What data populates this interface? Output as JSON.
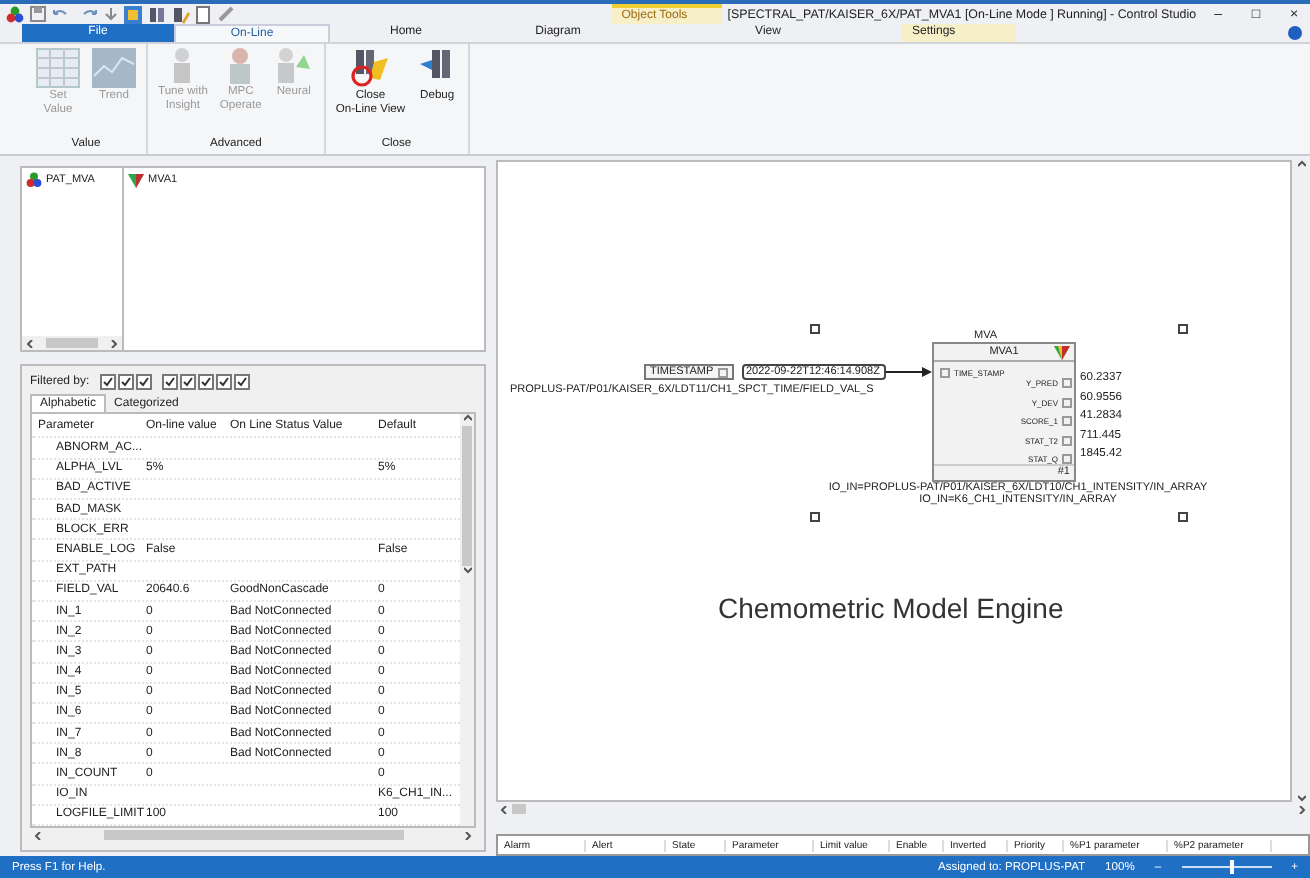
{
  "window": {
    "object_tools": "Object Tools",
    "title": "[SPECTRAL_PAT/KAISER_6X/PAT_MVA1 [On-Line Mode ] Running] - Control Studio",
    "minimize": "–",
    "maximize": "□",
    "close": "×"
  },
  "tabs": [
    {
      "label": "File",
      "kind": "file",
      "selected": false
    },
    {
      "label": "On-Line",
      "kind": "tab",
      "selected": true
    },
    {
      "label": "Home",
      "kind": "tab",
      "selected": false
    },
    {
      "label": "Diagram",
      "kind": "tab",
      "selected": false
    },
    {
      "label": "View",
      "kind": "tab",
      "selected": false
    },
    {
      "label": "Settings",
      "kind": "context",
      "selected": false
    }
  ],
  "ribbon": [
    {
      "label": "Value",
      "buttons": [
        {
          "label": "Set\nValue",
          "kind": "grid",
          "disabled": true
        },
        {
          "label": "Trend",
          "kind": "trend",
          "disabled": true
        }
      ]
    },
    {
      "label": "Advanced",
      "buttons": [
        {
          "label": "Tune with\nInsight",
          "kind": "tune",
          "disabled": true
        },
        {
          "label": "MPC\nOperate",
          "kind": "mpc",
          "disabled": true
        },
        {
          "label": "Neural",
          "kind": "neural",
          "disabled": true
        }
      ]
    },
    {
      "label": "Close",
      "buttons": [
        {
          "label": "Close\nOn-Line View",
          "kind": "close",
          "disabled": false
        },
        {
          "label": "Debug",
          "kind": "debug",
          "disabled": false
        }
      ]
    }
  ],
  "tree": {
    "root": "PAT_MVA",
    "items": [
      "MVA1"
    ]
  },
  "filter": {
    "label": "Filtered by:",
    "groups": [
      [
        true,
        true,
        true
      ],
      [
        true,
        true,
        true,
        true,
        true
      ]
    ]
  },
  "property_tabs": [
    {
      "label": "Alphabetic",
      "selected": true
    },
    {
      "label": "Categorized",
      "selected": false
    }
  ],
  "properties": {
    "columns": [
      "Parameter",
      "On-line value",
      "On Line Status Value",
      "Default"
    ],
    "rows": [
      [
        "ABNORM_AC...",
        "",
        "",
        ""
      ],
      [
        "ALPHA_LVL",
        "5%",
        "",
        "5%"
      ],
      [
        "BAD_ACTIVE",
        "",
        "",
        ""
      ],
      [
        "BAD_MASK",
        "",
        "",
        ""
      ],
      [
        "BLOCK_ERR",
        "",
        "",
        ""
      ],
      [
        "ENABLE_LOG",
        "False",
        "",
        "False"
      ],
      [
        "EXT_PATH",
        "",
        "",
        ""
      ],
      [
        "FIELD_VAL",
        "20640.6",
        "GoodNonCascade",
        "0"
      ],
      [
        "IN_1",
        "0",
        "Bad NotConnected",
        "0"
      ],
      [
        "IN_2",
        "0",
        "Bad NotConnected",
        "0"
      ],
      [
        "IN_3",
        "0",
        "Bad NotConnected",
        "0"
      ],
      [
        "IN_4",
        "0",
        "Bad NotConnected",
        "0"
      ],
      [
        "IN_5",
        "0",
        "Bad NotConnected",
        "0"
      ],
      [
        "IN_6",
        "0",
        "Bad NotConnected",
        "0"
      ],
      [
        "IN_7",
        "0",
        "Bad NotConnected",
        "0"
      ],
      [
        "IN_8",
        "0",
        "Bad NotConnected",
        "0"
      ],
      [
        "IN_COUNT",
        "0",
        "",
        "0"
      ],
      [
        "IO_IN",
        "",
        "",
        "K6_CH1_IN..."
      ],
      [
        "LOGFILE_LIMIT",
        "100",
        "",
        "100"
      ]
    ]
  },
  "diagram": {
    "input_name": "TIMESTAMP",
    "input_value": "2022-09-22T12:46:14.908Z",
    "input_path": "PROPLUS-PAT/P01/KAISER_6X/LDT11/CH1_SPCT_TIME/FIELD_VAL_S",
    "block_type": "MVA",
    "block_name": "MVA1",
    "block_input": "TIME_STAMP",
    "block_number": "#1",
    "outputs": [
      {
        "name": "Y_PRED",
        "value": "60.2337"
      },
      {
        "name": "Y_DEV",
        "value": "60.9556"
      },
      {
        "name": "SCORE_1",
        "value": "41.2834"
      },
      {
        "name": "STAT_T2",
        "value": "711.445"
      },
      {
        "name": "STAT_Q",
        "value": "1845.42"
      }
    ],
    "io_lines": [
      "IO_IN=PROPLUS-PAT/P01/KAISER_6X/LDT10/CH1_INTENSITY/IN_ARRAY",
      "IO_IN=K6_CH1_INTENSITY/IN_ARRAY"
    ],
    "caption": "Chemometric Model Engine"
  },
  "alarms": {
    "columns": [
      "Alarm",
      "Alert",
      "State",
      "Parameter",
      "Limit value",
      "Enable",
      "Inverted",
      "Priority",
      "%P1 parameter",
      "%P2 parameter"
    ]
  },
  "status_bar": {
    "help": "Press F1 for Help.",
    "assigned": "Assigned to: PROPLUS-PAT",
    "zoom": "100%",
    "minus": "–",
    "plus": "+",
    "level": 0.55
  }
}
